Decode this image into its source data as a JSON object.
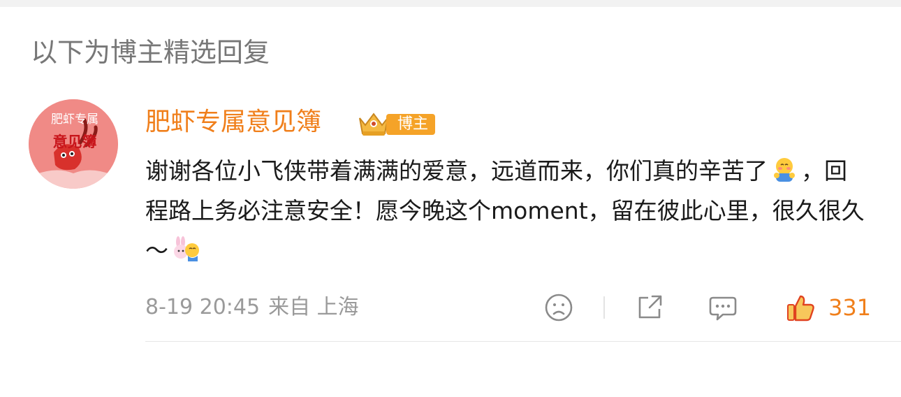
{
  "section_title": "以下为博主精选回复",
  "comment": {
    "username": "肥虾专属意见簿",
    "badge_label": "博主",
    "avatar_text": [
      "肥虾专属",
      "意见簿"
    ],
    "text_part1": "谢谢各位小飞侠带着满满的爱意，远道而来，你们真的辛苦了",
    "text_part2": "，回程路上务必注意安全！愿今晚这个moment，留在彼此心里，很久很久～",
    "timestamp": "8-19 20:45",
    "source": "来自 上海",
    "like_count": "331"
  },
  "icons": {
    "emoji1": "blushing-shy-emoji-icon",
    "emoji2": "rabbit-hug-emoji-icon",
    "dislike": "frown-face-icon",
    "share": "share-icon",
    "comment": "comment-icon",
    "like": "thumbs-up-icon"
  },
  "colors": {
    "accent": "#f07f1b",
    "badge": "#f5a328",
    "avatar_bg": "#f08a86",
    "meta_text": "#9a9a9a"
  }
}
